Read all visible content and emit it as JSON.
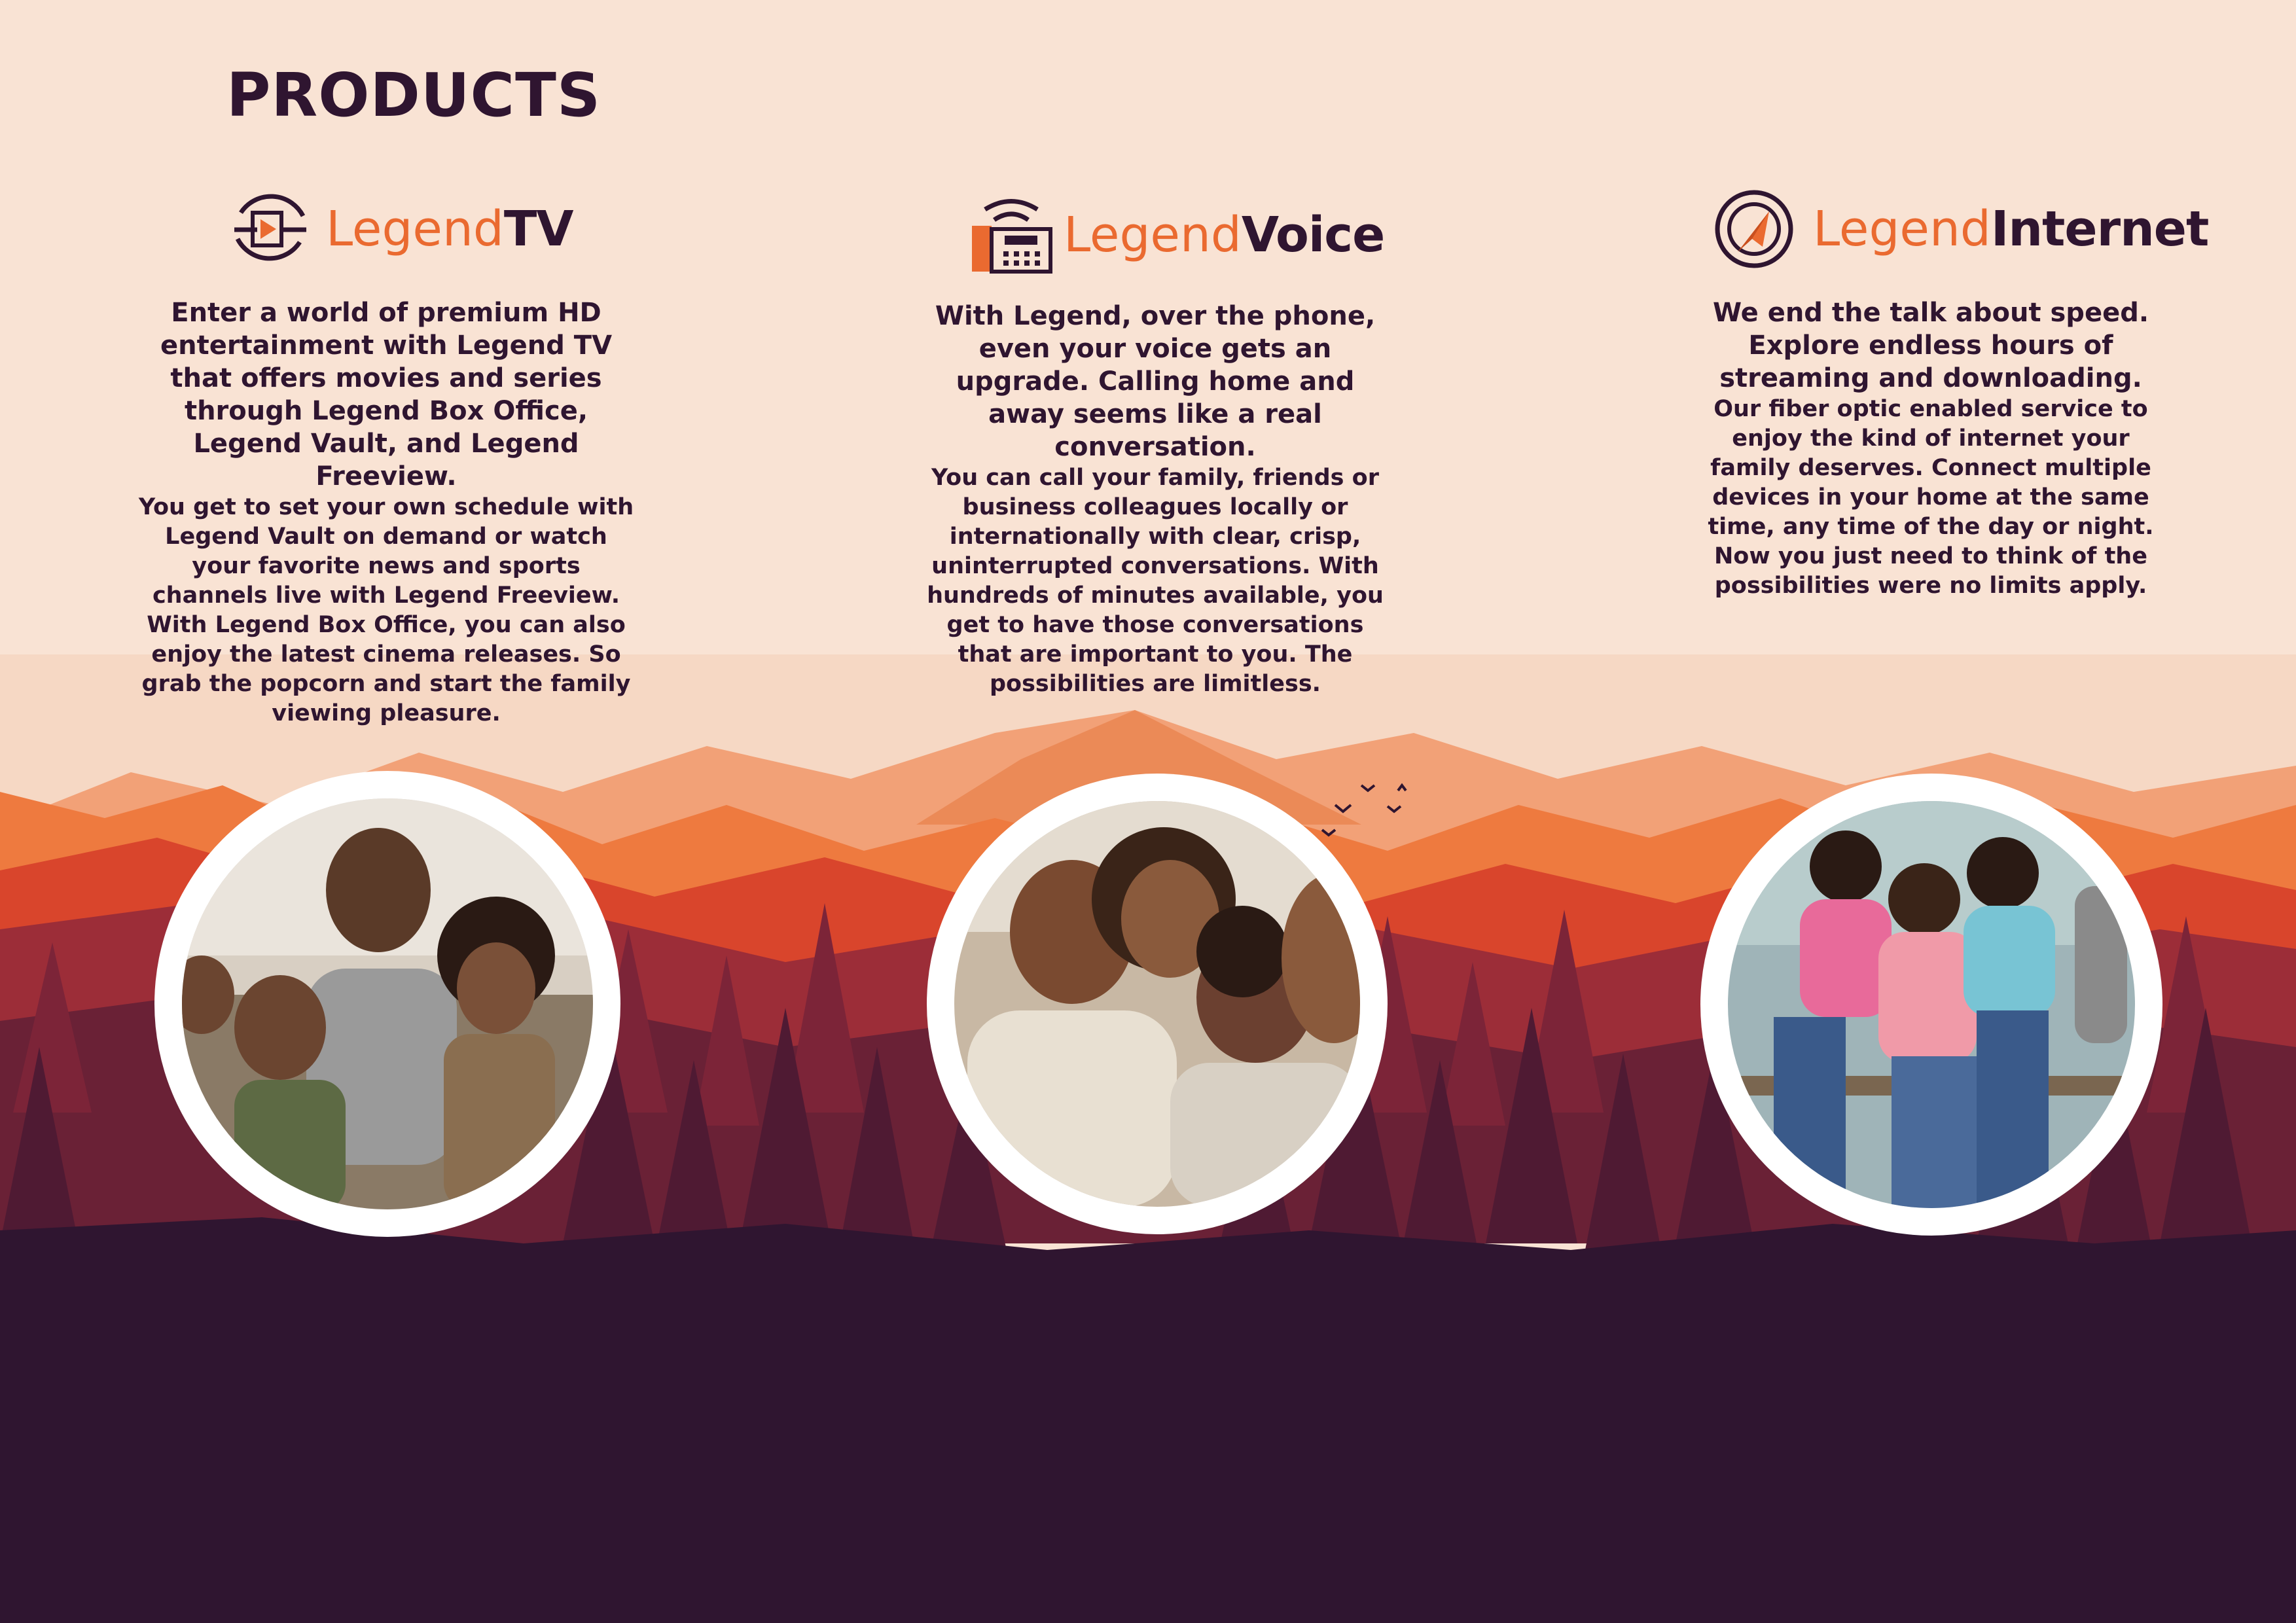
{
  "page": {
    "title": "PRODUCTS"
  },
  "products": [
    {
      "id": "tv",
      "brand_light": "Legend",
      "brand_bold": "TV",
      "lead": "Enter a world of premium HD entertainment with Legend TV that offers movies and series through Legend Box Office, Legend Vault, and Legend Freeview.",
      "body": "You get to set your own schedule with Legend Vault on demand or watch your favorite news and sports channels live with Legend Freeview. With Legend Box Office, you can also enjoy the latest cinema releases. So grab the popcorn and start the family viewing pleasure.",
      "icon": "play-icon"
    },
    {
      "id": "voice",
      "brand_light": "Legend",
      "brand_bold": "Voice",
      "lead": "With Legend, over the phone, even your voice gets an upgrade. Calling home and away seems like a real conversation.",
      "body": "You can call your family, friends or business colleagues locally or internationally with clear, crisp, uninterrupted conversations. With hundreds of minutes available, you get to have those conversations that are important to you. The possibilities are limitless.",
      "icon": "phone-icon"
    },
    {
      "id": "internet",
      "brand_light": "Legend",
      "brand_bold": "Internet",
      "lead": "We end the talk about speed. Explore endless hours of streaming and downloading.",
      "body": "Our fiber optic enabled service to enjoy the kind of internet your family deserves. Connect multiple devices in your home at the same time, any time of the day or night. Now you just need to think of the possibilities were no limits apply.",
      "icon": "cursor-arrow-icon"
    }
  ],
  "colors": {
    "background": "#f9e3d4",
    "accent": "#ea6a30",
    "dark": "#2f1530"
  }
}
